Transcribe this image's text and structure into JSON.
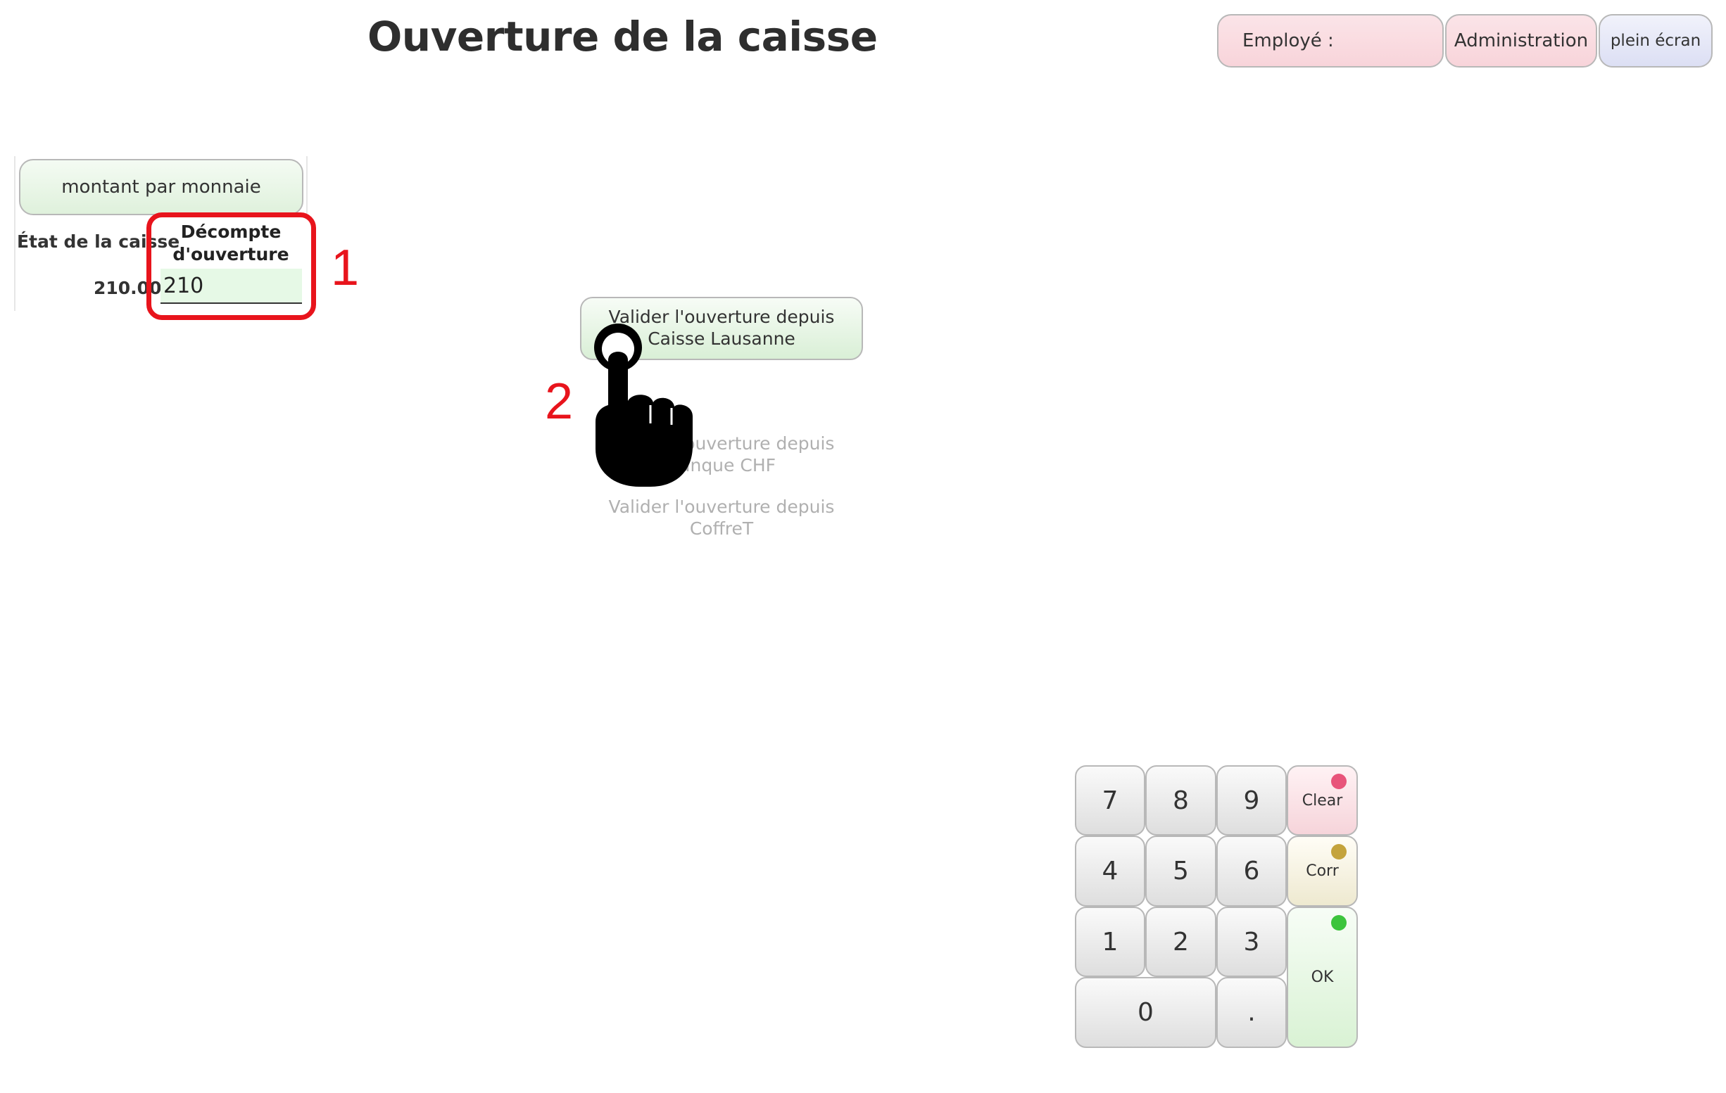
{
  "header": {
    "title": "Ouverture de la caisse",
    "employe_label": "Employé :",
    "admin_label": "Administration",
    "fullscreen_label": "plein écran"
  },
  "left_panel": {
    "monnaie_button": "montant par monnaie",
    "etat_label": "État de la caisse",
    "etat_value": "210.00",
    "decompte_label": "Décompte d'ouverture",
    "decompte_value": "210"
  },
  "actions": {
    "valider_lausanne": "Valider l'ouverture depuis Caisse Lausanne",
    "valider_banque": "Valider l'ouverture depuis Banque CHF",
    "valider_coffre": "Valider l'ouverture depuis CoffreT"
  },
  "annotations": {
    "step1": "1",
    "step2": "2",
    "highlight_color": "#e8141c",
    "pointer": "hand-pointer-icon"
  },
  "keypad": {
    "k7": "7",
    "k8": "8",
    "k9": "9",
    "k4": "4",
    "k5": "5",
    "k6": "6",
    "k1": "1",
    "k2": "2",
    "k3": "3",
    "k0": "0",
    "kdot": ".",
    "clear": "Clear",
    "corr": "Corr",
    "ok": "OK",
    "clear_color": "#e8547a",
    "corr_color": "#c4a33c",
    "ok_color": "#3cc43c"
  }
}
